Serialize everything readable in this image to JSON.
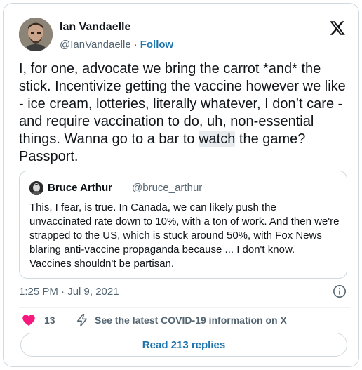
{
  "author": {
    "name": "Ian Vandaelle",
    "handle": "@IanVandaelle",
    "separator": "·",
    "follow_label": "Follow"
  },
  "tweet": {
    "text_before": "I, for one, advocate we bring the carrot *and* the stick. Incentivize getting the vaccine however we like - ice cream, lotteries, literally whatever, I don’t care - and require vaccination to do, uh, non-essential things. Wanna go to a bar to ",
    "text_highlight": "watch",
    "text_after": " the game? Passport.",
    "timestamp": "1:25 PM · Jul 9, 2021"
  },
  "quoted": {
    "name": "Bruce Arthur",
    "handle": "@bruce_arthur",
    "text": "This, I fear, is true. In Canada, we can likely push the unvaccinated rate down to 10%, with a ton of work. And then we're strapped to the US, which is stuck around 50%, with Fox News blaring anti-vaccine propaganda because ... I don't know. Vaccines shouldn't be partisan."
  },
  "actions": {
    "like_count": "13",
    "covid_info_label": "See the latest COVID-19 information on X",
    "replies_label": "Read 213 replies"
  },
  "icons": {
    "x_logo": "x-logo-icon",
    "info": "info-icon",
    "heart": "heart-icon",
    "bolt": "lightning-bolt-icon"
  },
  "colors": {
    "link": "#1d74ad",
    "heart": "#f91880",
    "muted": "#536471",
    "border": "#cfd9de"
  }
}
